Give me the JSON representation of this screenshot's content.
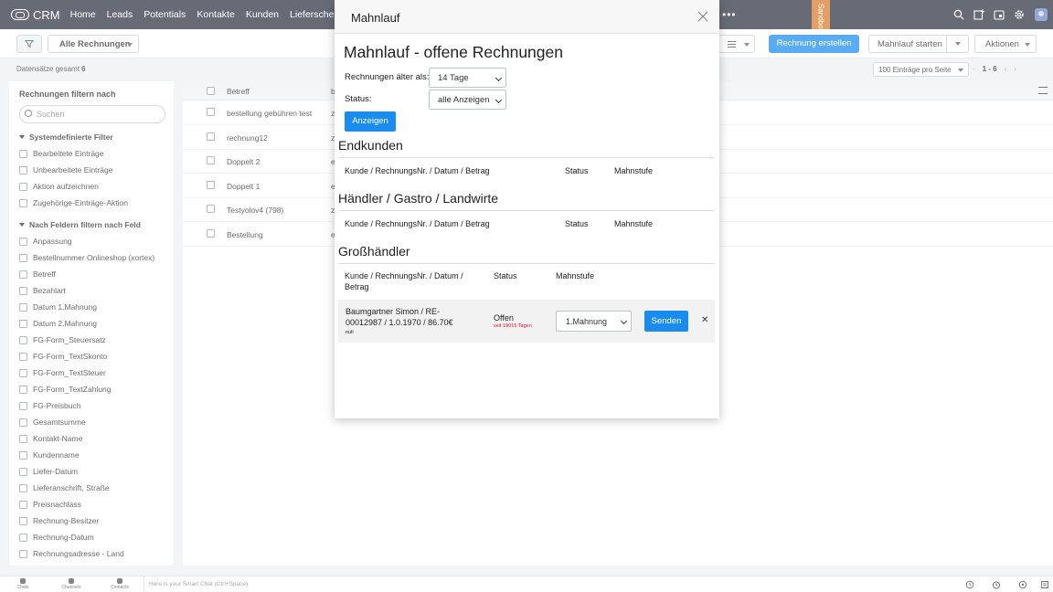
{
  "app": {
    "name": "CRM"
  },
  "nav": {
    "items": [
      "Home",
      "Leads",
      "Potentials",
      "Kontakte",
      "Kunden",
      "Lieferscheine"
    ],
    "more": "•••",
    "sandbox": "Sandbox"
  },
  "toolbar": {
    "view": "Alle Rechnungen",
    "create": "Rechnung erstellen",
    "mahnlauf": "Mahnlauf starten",
    "aktionen": "Aktionen"
  },
  "records": {
    "label": "Datensätze gesamt",
    "total": "6",
    "per_page": "100 Einträge pro Seite",
    "range": "1 - 6",
    "prev": "‹",
    "next": "›"
  },
  "filters": {
    "title": "Rechnungen filtern nach",
    "search_placeholder": "Suchen",
    "system_title": "Systemdefinierte Filter",
    "system_items": [
      "Bearbeitete Einträge",
      "Unbearbeitete Einträge",
      "Aktion aufzeichnen",
      "Zugehörige-Einträge-Aktion"
    ],
    "fields_title": "Nach Feldern filtern nach Feld",
    "field_items": [
      "Anpassung",
      "Bestellnummer Onlineshop (xortex)",
      "Betreff",
      "Bezahlart",
      "Datum 1.Mahnung",
      "Datum 2.Mahnung",
      "FG-Form_Steuersatz",
      "FG-Form_TextSkonto",
      "FG-Form_TextSteuer",
      "FG-Form_TextZahlung",
      "FG-Preisbuch",
      "Gesamtsumme",
      "Kontakt-Name",
      "Kundenname",
      "Liefer-Datum",
      "Lieferanschrift, Straße",
      "Preisnachlass",
      "Rechnung-Besitzer",
      "Rechnung-Datum",
      "Rechnungsadresse - Land"
    ]
  },
  "table": {
    "header": "Betreff",
    "header2": "b",
    "rows": [
      {
        "betreff": "bestellung gebühren test",
        "col2": "z"
      },
      {
        "betreff": "rechnung12",
        "col2": "z"
      },
      {
        "betreff": "Doppelt 2",
        "col2": "e"
      },
      {
        "betreff": "Doppelt 1",
        "col2": "e"
      },
      {
        "betreff": "Testyolov4 (798)",
        "col2": "z"
      },
      {
        "betreff": "Bestellung",
        "col2": "e"
      }
    ]
  },
  "bottom": {
    "chats": "Chats",
    "channels": "Channels",
    "contacts": "Contacts",
    "smartchat": "Here is your Smart Chat (Ctrl+Space)"
  },
  "modal": {
    "title": "Mahnlauf",
    "heading": "Mahnlauf - offene Rechnungen",
    "older_label": "Rechnungen älter als:",
    "older_value": "14 Tage",
    "status_label": "Status:",
    "status_value": "alle Anzeigen",
    "show_button": "Anzeigen",
    "col_kunde": "Kunde / RechnungsNr. / Datum / Betrag",
    "col_status": "Status",
    "col_mahnstufe": "Mahnstufe",
    "sections": [
      "Endkunden",
      "Händler / Gastro / Landwirte",
      "Großhändler"
    ],
    "row": {
      "kunde": "Baumgartner Simon / RE-00012987 / 1.0.1970 / 86.70€",
      "note": "null",
      "status": "Offen",
      "since": "seit 19015 Tagen",
      "level": "1.Mahnung",
      "send": "Senden",
      "remove": "✕"
    }
  }
}
